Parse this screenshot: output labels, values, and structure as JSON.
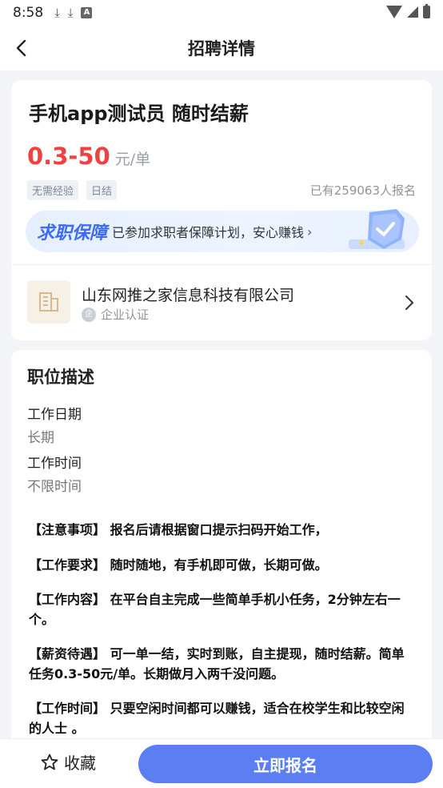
{
  "status_bar": {
    "time": "8:58",
    "a_icon_label": "A"
  },
  "nav": {
    "title": "招聘详情"
  },
  "job": {
    "title": "手机app测试员  随时结薪",
    "salary": "0.3-50",
    "salary_unit": "元/单",
    "tags": [
      "无需经验",
      "日结"
    ],
    "applicants": "已有259063人报名"
  },
  "guarantee": {
    "title": "求职保障",
    "text": "已参加求职者保障计划，安心赚钱",
    "arrow": "›"
  },
  "company": {
    "name": "山东网推之家信息科技有限公司",
    "verify_badge": "企",
    "verify_text": "企业认证"
  },
  "description": {
    "heading": "职位描述",
    "work_date_label": "工作日期",
    "work_date_value": "长期",
    "work_time_label": "工作时间",
    "work_time_value": "不限时间",
    "paragraphs": [
      "【注意事项】 报名后请根据窗口提示扫码开始工作，",
      "【工作要求】 随时随地，有手机即可做，长期可做。",
      "【工作内容】 在平台自主完成一些简单手机小任务，2分钟左右一个。",
      "【薪资待遇】 可一单一结，实时到账，自主提现，随时结薪。简单任务0.3-50元/单。长期做月入两千没问题。",
      "【工作时间】 只要空闲时间都可以赚钱，适合在校学生和比较空闲的人士 。"
    ]
  },
  "bottom": {
    "favorite_label": "收藏",
    "apply_label": "立即报名"
  },
  "colors": {
    "accent": "#5b7ef2",
    "salary": "#f23f3f",
    "guarantee_title": "#3d6bf5"
  }
}
